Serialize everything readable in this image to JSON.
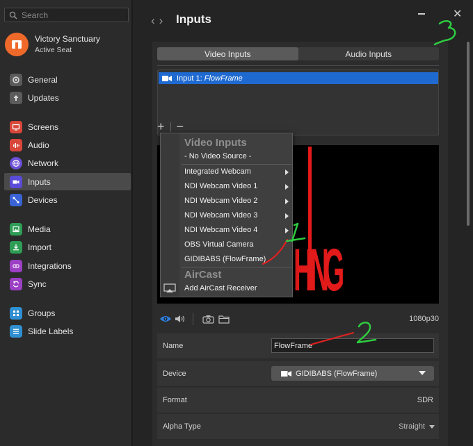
{
  "sidebar": {
    "search_placeholder": "Search",
    "account": {
      "name": "Victory Sanctuary",
      "seat": "Active Seat"
    },
    "items": [
      {
        "label": "General",
        "icon": "gear-icon",
        "color": "#5b5b5b"
      },
      {
        "label": "Updates",
        "icon": "update-icon",
        "color": "#5b5b5b"
      },
      {
        "label": "Screens",
        "icon": "screen-icon",
        "color": "#d9463a"
      },
      {
        "label": "Audio",
        "icon": "audio-icon",
        "color": "#d9463a"
      },
      {
        "label": "Network",
        "icon": "globe-icon",
        "color": "#6b4fd6"
      },
      {
        "label": "Inputs",
        "icon": "camera-icon",
        "color": "#5a4bd8"
      },
      {
        "label": "Devices",
        "icon": "devices-icon",
        "color": "#3a63d6"
      },
      {
        "label": "Media",
        "icon": "media-icon",
        "color": "#2e9d55"
      },
      {
        "label": "Import",
        "icon": "import-icon",
        "color": "#2e9d55"
      },
      {
        "label": "Integrations",
        "icon": "integrations-icon",
        "color": "#9b3fc4"
      },
      {
        "label": "Sync",
        "icon": "sync-icon",
        "color": "#9b3fc4"
      },
      {
        "label": "Groups",
        "icon": "groups-icon",
        "color": "#2f8fd0"
      },
      {
        "label": "Slide Labels",
        "icon": "labels-icon",
        "color": "#2f8fd0"
      }
    ]
  },
  "header": {
    "title": "Inputs"
  },
  "tabs": [
    "Video Inputs",
    "Audio Inputs"
  ],
  "input_list": {
    "prefix": "Input 1: ",
    "name": "FlowFrame"
  },
  "preview": {
    "resolution": "1080p30",
    "fragment_text": "HING"
  },
  "properties": {
    "name_label": "Name",
    "name_value": "FlowFrame",
    "device_label": "Device",
    "device_value": "GIDIBABS (FlowFrame)",
    "format_label": "Format",
    "format_value": "SDR",
    "alpha_label": "Alpha Type",
    "alpha_value": "Straight"
  },
  "dropdown": {
    "video_header": "Video Inputs",
    "no_source": "- No Video Source -",
    "items": [
      "Integrated Webcam",
      "NDI Webcam Video 1",
      "NDI Webcam Video 2",
      "NDI Webcam Video 3",
      "NDI Webcam Video 4",
      "OBS Virtual Camera",
      "GIDIBABS (FlowFrame)"
    ],
    "aircast_header": "AirCast",
    "aircast_item": "Add AirCast Receiver"
  },
  "annotations": {
    "one": "1",
    "two": "2",
    "three": "3"
  },
  "colors": {
    "selection": "#1f6ad1",
    "annotation": "#2ecc40",
    "annotation_red": "#e02020"
  }
}
